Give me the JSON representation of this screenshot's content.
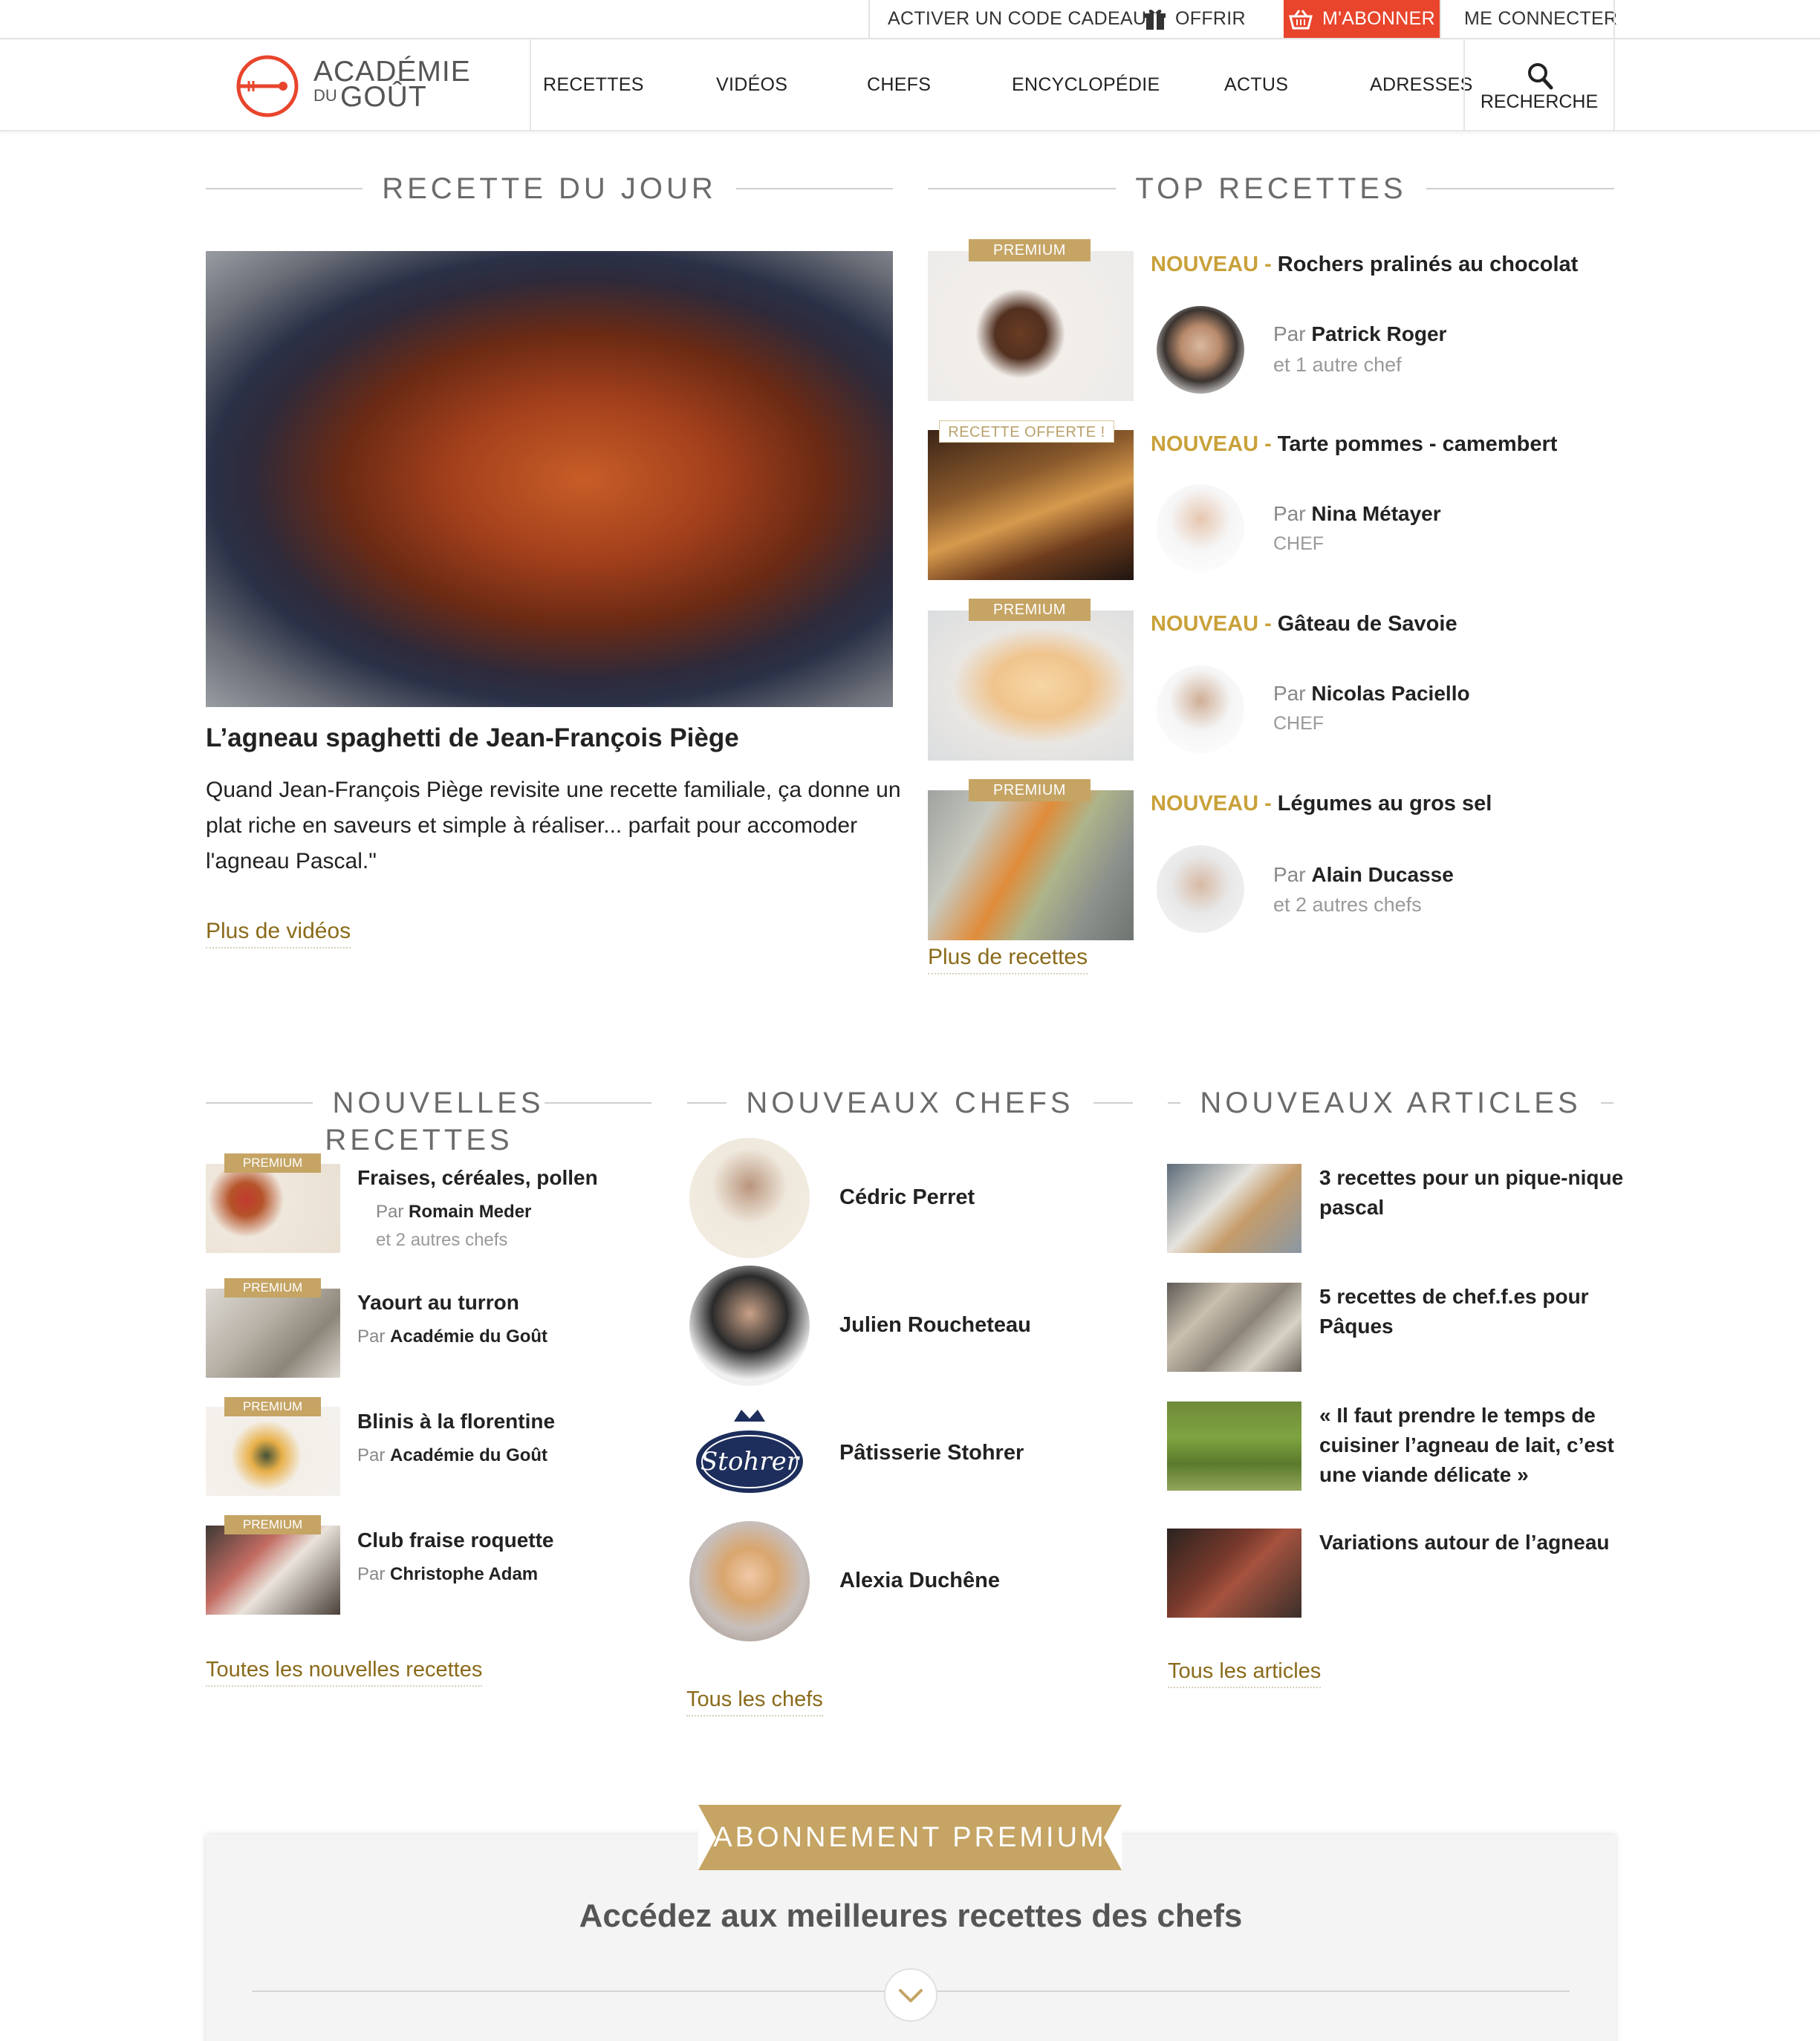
{
  "topbar": {
    "gift_code": "ACTIVER UN CODE CADEAU",
    "offer": "OFFRIR",
    "subscribe": "M'ABONNER",
    "login": "ME CONNECTER"
  },
  "logo": {
    "line1": "ACADÉMIE",
    "line2a": "DU",
    "line2b": "GOÛT"
  },
  "nav": {
    "items": [
      "RECETTES",
      "VIDÉOS",
      "CHEFS",
      "ENCYCLOPÉDIE",
      "ACTUS",
      "ADRESSES"
    ],
    "search": "RECHERCHE"
  },
  "recette_du_jour": {
    "heading": "RECETTE DU JOUR",
    "title": "L’agneau spaghetti de Jean-François Piège",
    "description": "Quand Jean-François Piège revisite une recette familiale, ça donne un plat riche en saveurs et simple à réaliser... parfait pour accomoder l'agneau Pascal.\"",
    "link": "Plus de vidéos"
  },
  "top_recettes": {
    "heading": "TOP RECETTES",
    "items": [
      {
        "badge": "PREMIUM",
        "prefix": "NOUVEAU - ",
        "title": "Rochers pralinés au chocolat",
        "by": "Par ",
        "chef": "Patrick Roger",
        "sub": "et 1 autre chef"
      },
      {
        "badge": "RECETTE OFFERTE !",
        "prefix": "NOUVEAU - ",
        "title": "Tarte pommes - camembert",
        "by": "Par ",
        "chef": "Nina Métayer",
        "sub": "CHEF"
      },
      {
        "badge": "PREMIUM",
        "prefix": "NOUVEAU - ",
        "title": "Gâteau de Savoie",
        "by": "Par ",
        "chef": "Nicolas Paciello",
        "sub": "CHEF"
      },
      {
        "badge": "PREMIUM",
        "prefix": "NOUVEAU - ",
        "title": "Légumes au gros sel",
        "by": "Par ",
        "chef": "Alain Ducasse",
        "sub": "et 2 autres chefs"
      }
    ],
    "link": "Plus de recettes"
  },
  "nouvelles_recettes": {
    "heading": "NOUVELLES RECETTES",
    "items": [
      {
        "badge": "PREMIUM",
        "title": "Fraises, céréales, pollen",
        "by": "Par ",
        "chef": "Romain Meder",
        "sub": "et 2 autres chefs"
      },
      {
        "badge": "PREMIUM",
        "title": "Yaourt au turron",
        "by": "Par ",
        "chef": "Académie du Goût",
        "sub": ""
      },
      {
        "badge": "PREMIUM",
        "title": "Blinis à la florentine",
        "by": "Par ",
        "chef": "Académie du Goût",
        "sub": ""
      },
      {
        "badge": "PREMIUM",
        "title": "Club fraise roquette",
        "by": "Par ",
        "chef": "Christophe Adam",
        "sub": ""
      }
    ],
    "link": "Toutes les nouvelles recettes"
  },
  "nouveaux_chefs": {
    "heading": "NOUVEAUX CHEFS",
    "items": [
      "Cédric Perret",
      "Julien Roucheteau",
      "Pâtisserie Stohrer",
      "Alexia Duchêne"
    ],
    "stohrer_logo_text": "Stohrer",
    "link": "Tous les chefs"
  },
  "nouveaux_articles": {
    "heading": "NOUVEAUX ARTICLES",
    "items": [
      {
        "l1": "3 recettes pour un pique-nique",
        "l2": "pascal",
        "l3": ""
      },
      {
        "l1": "5 recettes de chef.f.es pour",
        "l2": "Pâques",
        "l3": ""
      },
      {
        "l1": "« Il faut prendre le temps de",
        "l2": "cuisiner l’agneau de lait, c’est",
        "l3": "une viande délicate »"
      },
      {
        "l1": "Variations autour de l’agneau",
        "l2": "",
        "l3": ""
      }
    ],
    "link": "Tous les articles"
  },
  "premium": {
    "banner": "ABONNEMENT PREMIUM",
    "title": "Accédez aux meilleures recettes des chefs"
  },
  "colors": {
    "accent": "#e8452c",
    "gold": "#c5a464",
    "gold_text": "#8a6a1a",
    "nouveau": "#c9a13a"
  }
}
